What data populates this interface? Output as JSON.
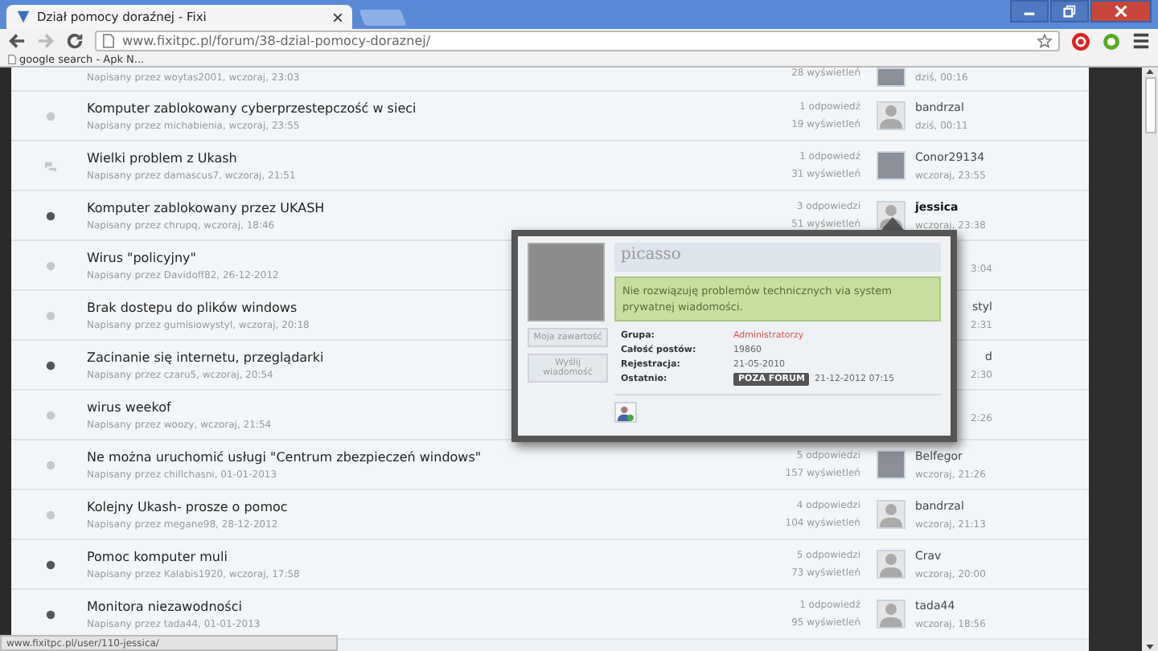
{
  "browser": {
    "tab_title": "Dział pomocy doraźnej - Fixi",
    "url": "www.fixitpc.pl/forum/38-dzial-pomocy-doraznej/",
    "bookmarks": [
      "google search - Apk N..."
    ]
  },
  "topics": [
    {
      "kind": "full",
      "meta": "Napisany przez woytas2001, wczoraj, 23:03",
      "views": "28 wyświetleń",
      "has_photo": true,
      "last_time": "dziś, 00:16"
    },
    {
      "kind": "full",
      "unread": false,
      "posted": false,
      "title": "Komputer zablokowany cyberprzestepczość w sieci",
      "meta": "Napisany przez michabienia, wczoraj, 23:55",
      "replies": "1 odpowiedź",
      "views": "19 wyświetleń",
      "has_photo": false,
      "last_user": "bandrzal",
      "last_time": "dziś, 00:11",
      "bold_user": false
    },
    {
      "kind": "full",
      "unread": false,
      "posted": true,
      "title": "Wielki problem z Ukash",
      "meta": "Napisany przez damascus7, wczoraj, 21:51",
      "replies": "1 odpowiedź",
      "views": "31 wyświetleń",
      "has_photo": true,
      "last_user": "Conor29134",
      "last_time": "wczoraj, 23:55",
      "bold_user": false
    },
    {
      "kind": "full",
      "unread": true,
      "posted": false,
      "title": "Komputer zablokowany przez UKASH",
      "meta": "Napisany przez chrupq, wczoraj, 18:46",
      "replies": "3 odpowiedzi",
      "views": "51 wyświetleń",
      "has_photo": false,
      "last_user": "jessica",
      "last_time": "wczoraj, 23:38",
      "bold_user": true
    },
    {
      "kind": "covered",
      "unread": false,
      "posted": false,
      "title": "Wirus \"policyjny\"",
      "meta": "Napisany przez Davidoff82, 26-12-2012",
      "last_time": "3:04"
    },
    {
      "kind": "covered",
      "unread": false,
      "posted": false,
      "title": "Brak dostepu do plików windows",
      "meta": "Napisany przez gumisiowystyl, wczoraj, 20:18",
      "last_user": "styl",
      "last_time": "2:31"
    },
    {
      "kind": "covered",
      "unread": true,
      "posted": false,
      "title": "Zacinanie się internetu, przeglądarki",
      "meta": "Napisany przez czaru5, wczoraj, 20:54",
      "last_user": "d",
      "last_time": "2:30"
    },
    {
      "kind": "covered",
      "unread": false,
      "posted": false,
      "title": "wirus weekof",
      "meta": "Napisany przez woozy, wczoraj, 21:54",
      "last_time": "2:26"
    },
    {
      "kind": "full",
      "unread": false,
      "posted": false,
      "title": "Ne można uruchomić usługi \"Centrum zbezpieczeń windows\"",
      "meta": "Napisany przez chillchasni, 01-01-2013",
      "replies": "5 odpowiedzi",
      "views": "157 wyświetleń",
      "has_photo": true,
      "last_user": "Belfegor",
      "last_time": "wczoraj, 21:26",
      "bold_user": false
    },
    {
      "kind": "full",
      "unread": false,
      "posted": false,
      "title": "Kolejny Ukash- prosze o pomoc",
      "meta": "Napisany przez megane98, 28-12-2012",
      "replies": "4 odpowiedzi",
      "views": "104 wyświetleń",
      "has_photo": false,
      "last_user": "bandrzal",
      "last_time": "wczoraj, 21:13",
      "bold_user": false
    },
    {
      "kind": "full",
      "unread": true,
      "posted": false,
      "title": "Pomoc komputer muli",
      "meta": "Napisany przez Kalabis1920, wczoraj, 17:58",
      "replies": "5 odpowiedzi",
      "views": "73 wyświetleń",
      "has_photo": false,
      "last_user": "Crav",
      "last_time": "wczoraj, 20:00",
      "bold_user": false
    },
    {
      "kind": "full",
      "unread": true,
      "posted": false,
      "title": "Monitora niezawodności",
      "meta": "Napisany przez tada44, 01-01-2013",
      "replies": "1 odpowiedź",
      "views": "95 wyświetleń",
      "has_photo": false,
      "last_user": "tada44",
      "last_time": "wczoraj, 18:56",
      "bold_user": false
    }
  ],
  "popup": {
    "name": "picasso",
    "message": "Nie rozwiązuję problemów technicznych via system prywatnej wiadomości.",
    "buttons": [
      "Moja zawartość",
      "Wyślij wiadomość"
    ],
    "fields": [
      {
        "label": "Grupa:",
        "value": "Administratorzy",
        "kind": "group"
      },
      {
        "label": "Całość postów:",
        "value": "19860",
        "kind": "text"
      },
      {
        "label": "Rejestracja:",
        "value": "21-05-2010",
        "kind": "text"
      },
      {
        "label": "Ostatnio:",
        "badge": "POZA FORUM",
        "value": "21-12-2012 07:15",
        "kind": "badge"
      }
    ]
  },
  "status_bar": {
    "url": "www.fixitpc.pl/user/110-jessica/"
  }
}
